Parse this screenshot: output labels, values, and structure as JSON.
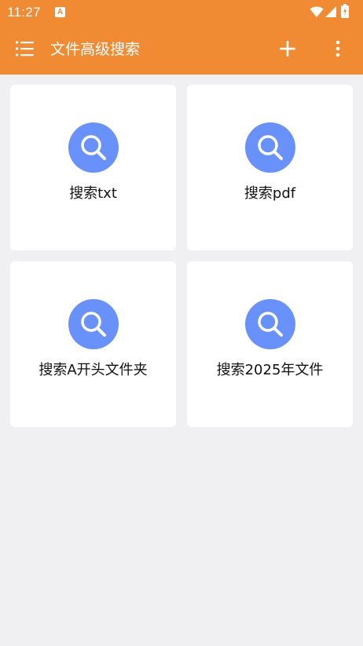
{
  "status_bar": {
    "time": "11:27",
    "notification_icon": "a-icon",
    "icons": [
      "wifi-icon",
      "cellular-signal-icon",
      "battery-icon"
    ]
  },
  "toolbar": {
    "title": "文件高级搜索",
    "menu_icon": "list-menu-icon",
    "add_icon": "plus-icon",
    "more_icon": "more-vertical-icon",
    "background_color": "#f18b33"
  },
  "cards": [
    {
      "label": "搜索txt",
      "icon": "search-icon"
    },
    {
      "label": "搜索pdf",
      "icon": "search-icon"
    },
    {
      "label": "搜索A开头文件夹",
      "icon": "search-icon"
    },
    {
      "label": "搜索2025年文件",
      "icon": "search-icon"
    }
  ],
  "colors": {
    "accent": "#f18b33",
    "icon_circle": "#6991fb",
    "page_background": "#f0f0f3",
    "card_background": "#ffffff"
  }
}
